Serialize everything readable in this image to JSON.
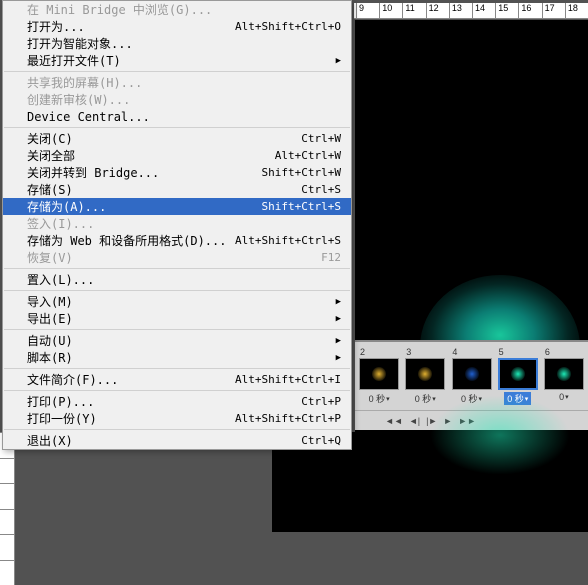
{
  "ruler_top": [
    "9",
    "10",
    "11",
    "12",
    "13",
    "14",
    "15",
    "16",
    "17",
    "18"
  ],
  "ruler_left": [
    " ",
    " ",
    " ",
    " ",
    " ",
    " "
  ],
  "menu": [
    {
      "label": "在 Mini Bridge 中浏览(G)...",
      "shortcut": "",
      "disabled": true
    },
    {
      "label": "打开为...",
      "shortcut": "Alt+Shift+Ctrl+O"
    },
    {
      "label": "打开为智能对象...",
      "shortcut": ""
    },
    {
      "label": "最近打开文件(T)",
      "shortcut": "",
      "arrow": true
    },
    {
      "sep": true
    },
    {
      "label": "共享我的屏幕(H)...",
      "shortcut": "",
      "disabled": true
    },
    {
      "label": "创建新审核(W)...",
      "shortcut": "",
      "disabled": true
    },
    {
      "label": "Device Central...",
      "shortcut": ""
    },
    {
      "sep": true
    },
    {
      "label": "关闭(C)",
      "shortcut": "Ctrl+W"
    },
    {
      "label": "关闭全部",
      "shortcut": "Alt+Ctrl+W"
    },
    {
      "label": "关闭并转到 Bridge...",
      "shortcut": "Shift+Ctrl+W"
    },
    {
      "label": "存储(S)",
      "shortcut": "Ctrl+S"
    },
    {
      "label": "存储为(A)...",
      "shortcut": "Shift+Ctrl+S",
      "highlighted": true
    },
    {
      "label": "签入(I)...",
      "shortcut": "",
      "disabled": true
    },
    {
      "label": "存储为 Web 和设备所用格式(D)...",
      "shortcut": "Alt+Shift+Ctrl+S"
    },
    {
      "label": "恢复(V)",
      "shortcut": "F12",
      "disabled": true
    },
    {
      "sep": true
    },
    {
      "label": "置入(L)...",
      "shortcut": ""
    },
    {
      "sep": true
    },
    {
      "label": "导入(M)",
      "shortcut": "",
      "arrow": true
    },
    {
      "label": "导出(E)",
      "shortcut": "",
      "arrow": true
    },
    {
      "sep": true
    },
    {
      "label": "自动(U)",
      "shortcut": "",
      "arrow": true
    },
    {
      "label": "脚本(R)",
      "shortcut": "",
      "arrow": true
    },
    {
      "sep": true
    },
    {
      "label": "文件简介(F)...",
      "shortcut": "Alt+Shift+Ctrl+I"
    },
    {
      "sep": true
    },
    {
      "label": "打印(P)...",
      "shortcut": "Ctrl+P"
    },
    {
      "label": "打印一份(Y)",
      "shortcut": "Alt+Shift+Ctrl+P"
    },
    {
      "sep": true
    },
    {
      "label": "退出(X)",
      "shortcut": "Ctrl+Q"
    }
  ],
  "frames": [
    {
      "num": "2",
      "dur": "0 秒",
      "color": "#e0b030"
    },
    {
      "num": "3",
      "dur": "0 秒",
      "color": "#e0b030"
    },
    {
      "num": "4",
      "dur": "0 秒",
      "color": "#2060d0"
    },
    {
      "num": "5",
      "dur": "0 秒",
      "color": "#1de9b6",
      "selected": true
    },
    {
      "num": "6",
      "dur": "0",
      "color": "#1de9b6"
    }
  ],
  "playback": {
    "icons": [
      "◄◄",
      "◄|",
      "|►",
      "►",
      "►►"
    ]
  }
}
